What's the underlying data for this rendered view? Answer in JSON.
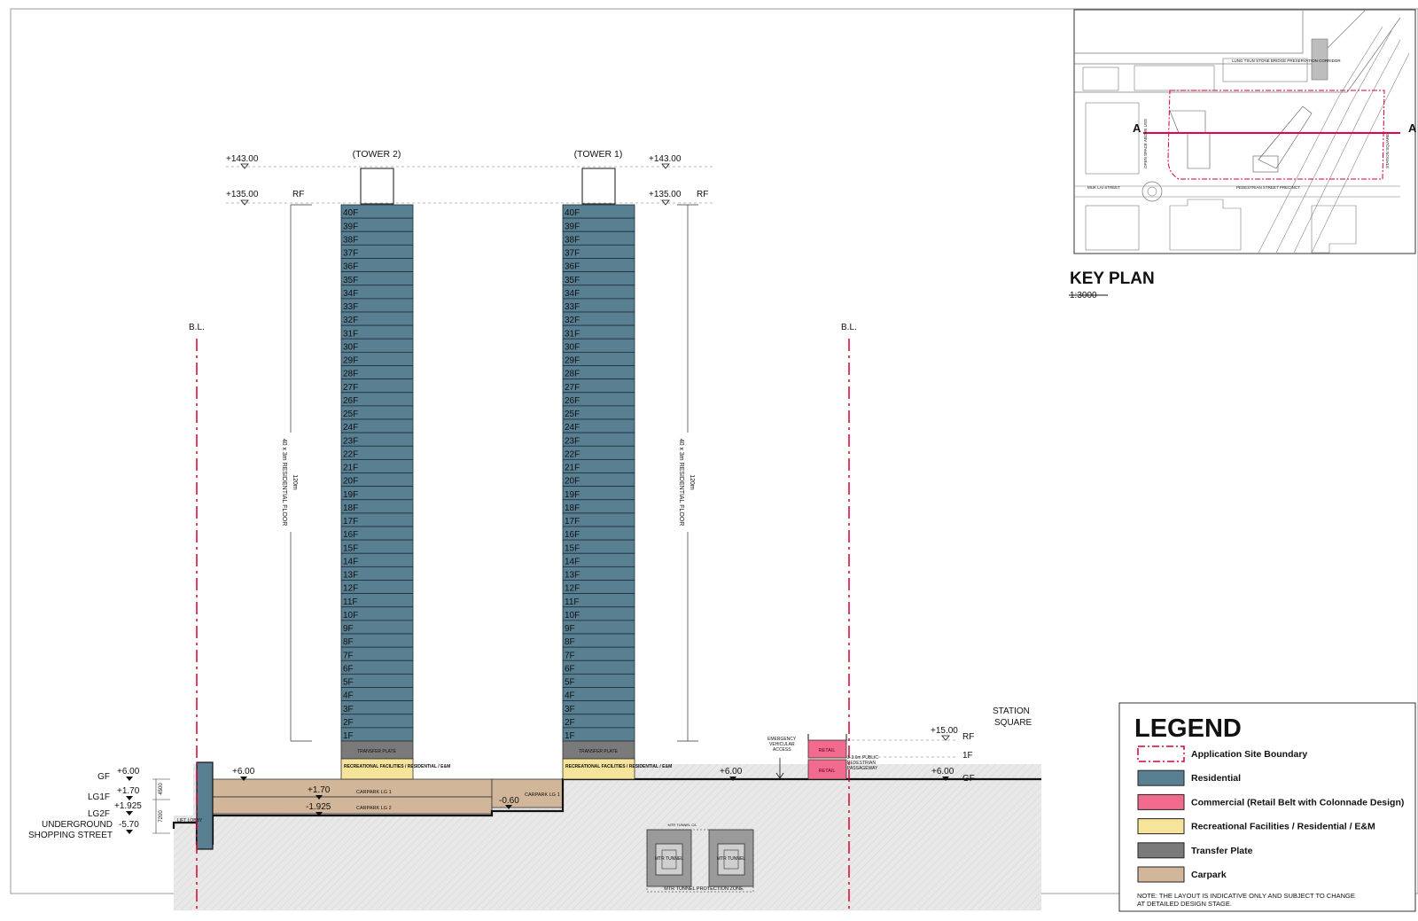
{
  "towers": [
    {
      "name": "(TOWER 2)",
      "top_level": "+143.00",
      "roof_level": "+135.00",
      "roof_label": "RF",
      "dim_height": "120m",
      "dim_desc": "40 x 3m RESIDENTIAL FLOOR"
    },
    {
      "name": "(TOWER 1)",
      "top_level": "+143.00",
      "roof_level": "+135.00",
      "roof_label": "RF",
      "dim_height": "120m",
      "dim_desc": "40 x 3m RESIDENTIAL FLOOR"
    }
  ],
  "floors": [
    "40F",
    "39F",
    "38F",
    "37F",
    "36F",
    "35F",
    "34F",
    "33F",
    "32F",
    "31F",
    "30F",
    "29F",
    "28F",
    "27F",
    "26F",
    "25F",
    "24F",
    "23F",
    "22F",
    "21F",
    "20F",
    "19F",
    "18F",
    "17F",
    "16F",
    "15F",
    "14F",
    "13F",
    "12F",
    "11F",
    "10F",
    "9F",
    "8F",
    "7F",
    "6F",
    "5F",
    "4F",
    "3F",
    "2F",
    "1F"
  ],
  "podium": {
    "transfer_plate": "TRANSFER PLATE",
    "recreational": "RECREATIONAL FACILITIES / RESIDENTIAL / E&M"
  },
  "building_line": "B.L.",
  "left_levels": {
    "gf": "GF",
    "gf_val": "+6.00",
    "lg1": "LG1F",
    "lg1_val": "+1.70",
    "lg2": "LG2F",
    "lg2_val": "+1.925",
    "underground": "UNDERGROUND",
    "shopping": "SHOPPING STREET",
    "ug_val": "-5.70",
    "dim1": "4500",
    "dim2": "7200",
    "lift": "LIFT LOBBY"
  },
  "section_labels": {
    "plus600_a": "+6.00",
    "carpark_lg1_val": "+1.70",
    "carpark_lg1": "CARPARK LG 1",
    "carpark_lg2_val": "-1.925",
    "carpark_lg2": "CARPARK LG 2",
    "carpark_right_val": "-0.60",
    "carpark_right": "CARPARK LG 1",
    "plus600_b": "+6.00",
    "plus600_c": "+6.00",
    "gf_right": "GF",
    "plus1500": "+15.00",
    "rf_right": "RF",
    "f1_right": "1F",
    "station_square_1": "STATION",
    "station_square_2": "SQUARE",
    "emergency_1": "EMERGENCY",
    "emergency_2": "VEHICULAR",
    "emergency_3": "ACCESS",
    "retail": "RETAIL",
    "passage_1": "3-3.6m PUBLIC",
    "passage_2": "PEDESTRIAN",
    "passage_3": "PASSAGEWAY",
    "mtr_tunnel": "MTR TUNNEL",
    "mtr_tunnel_small": "MTR TUNNEL C/L",
    "mtr_zone": "MTR TUNNEL PROTECTION ZONE"
  },
  "key_plan": {
    "title": "KEY PLAN",
    "scale": "1:3000",
    "section_marker": "A",
    "street_1": "MUK LAI STREET",
    "street_2": "PEDESTRIAN STREET PRECINCT",
    "station": "STATION SQUARE",
    "open_space": "OPEN SPACE ABOVE USS",
    "corridor": "LUNG TSUN STONE BRIDGE PRESERVATION CORRIDOR"
  },
  "legend": {
    "title": "LEGEND",
    "items": [
      {
        "label": "Application Site Boundary",
        "color": "#ffffff",
        "border": "#d6002e",
        "dashed": true
      },
      {
        "label": "Residential",
        "color": "#587f92",
        "border": "#222",
        "dashed": false
      },
      {
        "label": "Commercial (Retail Belt with Colonnade Design)",
        "color": "#f36a8f",
        "border": "#222",
        "dashed": false
      },
      {
        "label": "Recreational Facilities / Residential / E&M",
        "color": "#f6e49a",
        "border": "#222",
        "dashed": false
      },
      {
        "label": "Transfer Plate",
        "color": "#7a7a7a",
        "border": "#222",
        "dashed": false
      },
      {
        "label": "Carpark",
        "color": "#d2b69a",
        "border": "#222",
        "dashed": false
      }
    ],
    "note_1": "NOTE: THE LAYOUT IS INDICATIVE ONLY AND SUBJECT TO CHANGE",
    "note_2": "AT DETAILED DESIGN STAGE."
  },
  "colors": {
    "residential": "#587f92",
    "transfer": "#7a7a7a",
    "recreational": "#f6e49a",
    "carpark": "#d2b69a",
    "retail": "#f36a8f",
    "boundary": "#d6002e",
    "ground": "#e6e6e6"
  }
}
